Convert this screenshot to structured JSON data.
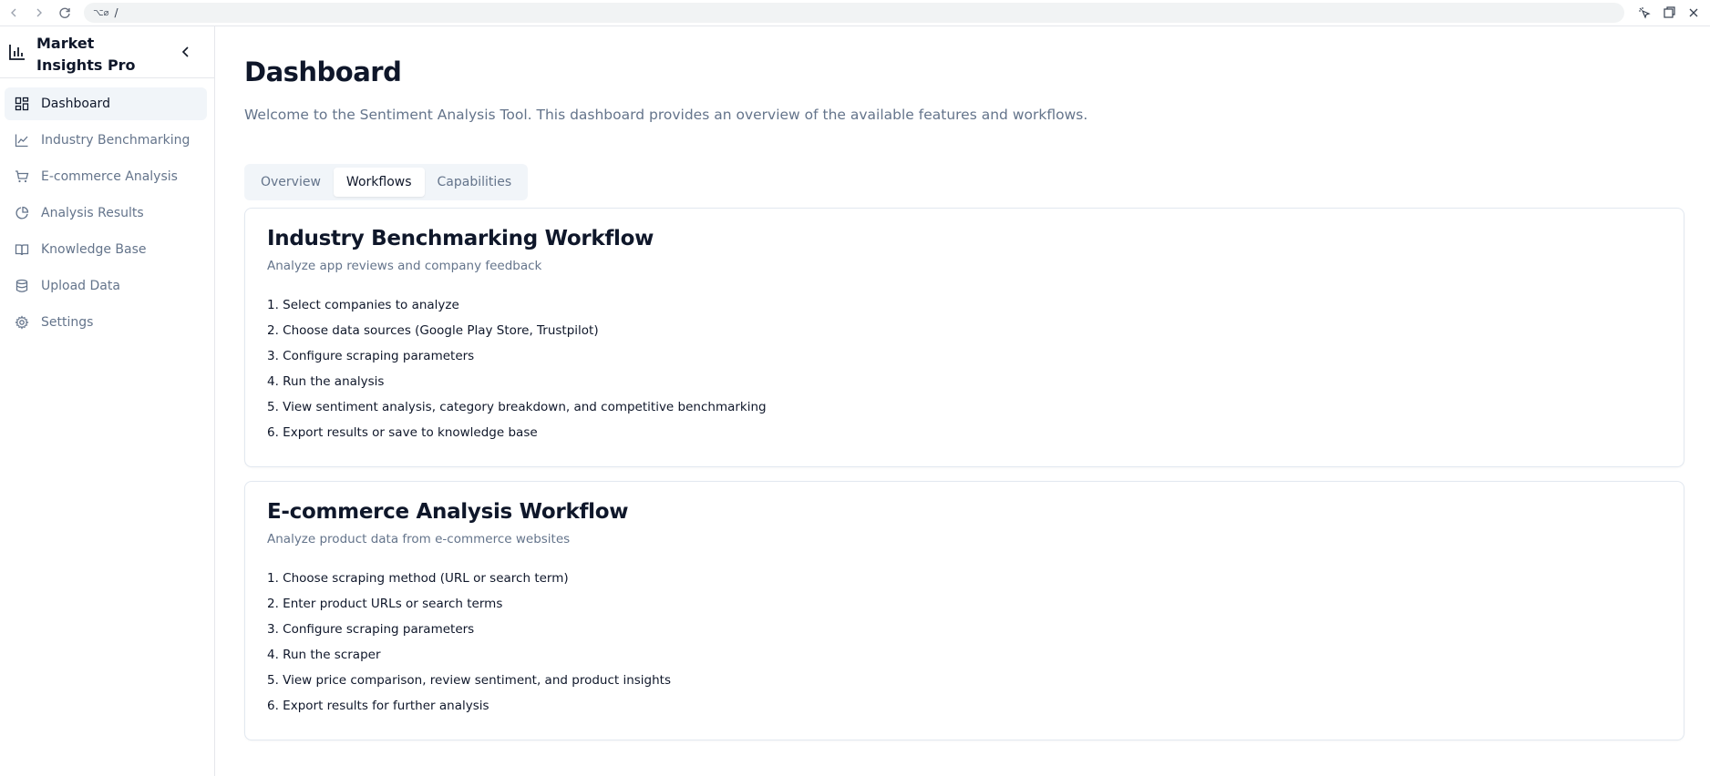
{
  "browser": {
    "url": "/",
    "url_icon": "⌥⌀"
  },
  "sidebar": {
    "app_title": "Market Insights Pro",
    "items": [
      {
        "label": "Dashboard",
        "icon": "dashboard-grid-icon",
        "active": true
      },
      {
        "label": "Industry Benchmarking",
        "icon": "line-chart-icon",
        "active": false
      },
      {
        "label": "E-commerce Analysis",
        "icon": "shopping-cart-icon",
        "active": false
      },
      {
        "label": "Analysis Results",
        "icon": "pie-chart-icon",
        "active": false
      },
      {
        "label": "Knowledge Base",
        "icon": "book-open-icon",
        "active": false
      },
      {
        "label": "Upload Data",
        "icon": "database-icon",
        "active": false
      },
      {
        "label": "Settings",
        "icon": "gear-icon",
        "active": false
      }
    ]
  },
  "main": {
    "title": "Dashboard",
    "subtitle": "Welcome to the Sentiment Analysis Tool. This dashboard provides an overview of the available features and workflows.",
    "tabs": [
      {
        "label": "Overview",
        "active": false
      },
      {
        "label": "Workflows",
        "active": true
      },
      {
        "label": "Capabilities",
        "active": false
      }
    ],
    "cards": [
      {
        "title": "Industry Benchmarking Workflow",
        "description": "Analyze app reviews and company feedback",
        "steps": [
          "1. Select companies to analyze",
          "2. Choose data sources (Google Play Store, Trustpilot)",
          "3. Configure scraping parameters",
          "4. Run the analysis",
          "5. View sentiment analysis, category breakdown, and competitive benchmarking",
          "6. Export results or save to knowledge base"
        ]
      },
      {
        "title": "E-commerce Analysis Workflow",
        "description": "Analyze product data from e-commerce websites",
        "steps": [
          "1. Choose scraping method (URL or search term)",
          "2. Enter product URLs or search terms",
          "3. Configure scraping parameters",
          "4. Run the scraper",
          "5. View price comparison, review sentiment, and product insights",
          "6. Export results for further analysis"
        ]
      }
    ]
  }
}
